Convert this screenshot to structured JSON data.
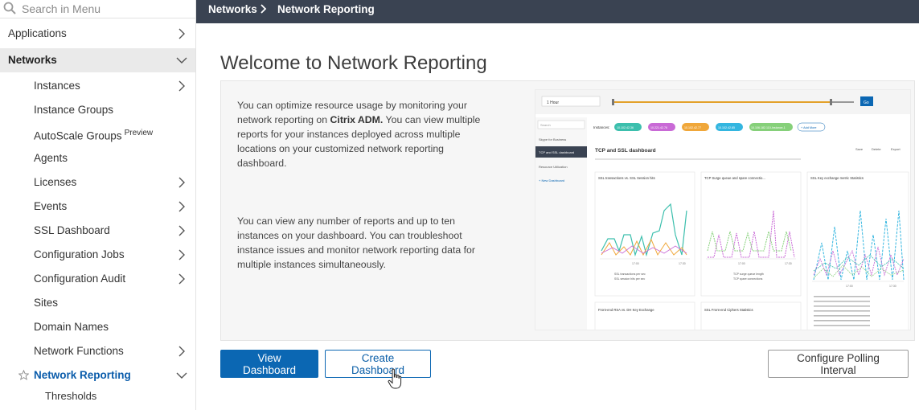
{
  "search": {
    "placeholder": "Search in Menu"
  },
  "sidebar": {
    "items": [
      {
        "label": "Applications"
      },
      {
        "label": "Networks"
      },
      {
        "label": "Instances"
      },
      {
        "label": "Instance Groups"
      },
      {
        "label": "AutoScale Groups",
        "badge": "Preview"
      },
      {
        "label": "Agents"
      },
      {
        "label": "Licenses"
      },
      {
        "label": "Events"
      },
      {
        "label": "SSL Dashboard"
      },
      {
        "label": "Configuration Jobs"
      },
      {
        "label": "Configuration Audit"
      },
      {
        "label": "Sites"
      },
      {
        "label": "Domain Names"
      },
      {
        "label": "Network Functions"
      },
      {
        "label": "Network Reporting"
      },
      {
        "label": "Thresholds"
      }
    ]
  },
  "breadcrumb": {
    "items": [
      "Networks",
      "Network Reporting"
    ]
  },
  "page": {
    "title": "Welcome to Network Reporting",
    "para1_a": "You can optimize resource usage by monitoring your network reporting on ",
    "para1_brand": "Citrix ADM.",
    "para1_b": " You can view multiple reports for your instances deployed across multiple locations on your customized network reporting dashboard.",
    "para2": "You can view any number of reports and up to ten instances on your dashboard. You can troubleshoot instance issues and monitor network reporting data for multiple instances simultaneously."
  },
  "buttons": {
    "view_dashboard": "View Dashboard",
    "create_dashboard": "Create Dashboard",
    "configure_polling": "Configure Polling Interval"
  },
  "preview": {
    "range": "1 Hour",
    "go": "Go",
    "search": "Search",
    "instances": "Instances:",
    "chips": [
      "10.102.42.36",
      "10.221.42.76",
      "10.102.42.77",
      "10.102.42.85",
      "10.106.182.110-Instance-1"
    ],
    "add_more": "+ Add More",
    "nav": [
      "Skype for Business",
      "TCP and SSL dashboard",
      "Resource Utilization"
    ],
    "new_dashboard": "+ New Dashboard",
    "dash_title": "TCP and SSL dashboard",
    "save": "Save",
    "delete": "Delete",
    "export": "Export",
    "charts": [
      "SSL transactions vs. SSL Session hits",
      "TCP Surge queue and spare connectio...",
      "SSL Key exchange metric Statistics",
      "Front-end RSA vs. DH Key Exchange",
      "SSL Front-end Ciphers Statistics"
    ],
    "legend1": [
      "SSL transactions per sec",
      "SSL session hits per sec"
    ],
    "legend2": [
      "TCP surge queue length",
      "TCP spare connections"
    ],
    "ticks": [
      "17:00",
      "17:30"
    ]
  },
  "colors": {
    "topbar": "#3a4352",
    "primary": "#0b67b3",
    "active_link": "#0a5cab"
  }
}
